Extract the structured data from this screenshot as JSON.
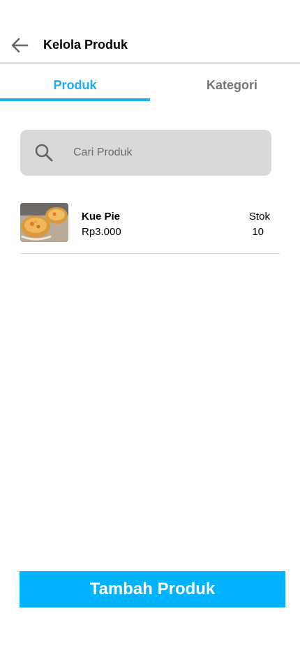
{
  "header": {
    "title": "Kelola Produk",
    "back_icon": "arrow-left-icon"
  },
  "tabs": [
    {
      "label": "Produk",
      "active": true
    },
    {
      "label": "Kategori",
      "active": false
    }
  ],
  "colors": {
    "accent": "#1aaff0",
    "button": "#00b2ff",
    "search_bg": "#d9d9d9"
  },
  "search": {
    "placeholder": "Cari Produk",
    "value": "",
    "icon": "search-icon"
  },
  "products": [
    {
      "name": "Kue Pie",
      "price": "Rp3.000",
      "stock_label": "Stok",
      "stock": "10",
      "image": "pie-image"
    }
  ],
  "footer": {
    "add_label": "Tambah Produk"
  }
}
